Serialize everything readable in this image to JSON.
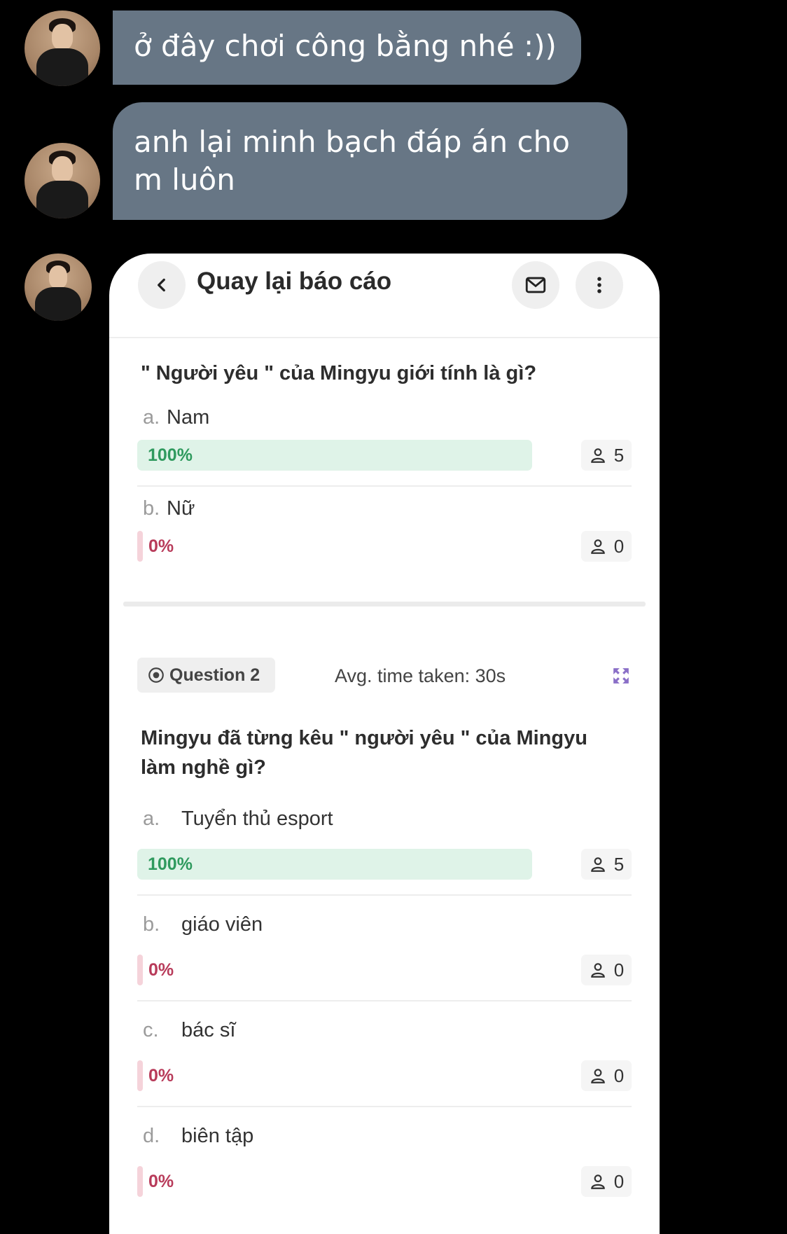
{
  "messages": [
    {
      "text": "ở đây chơi công bằng nhé :))"
    },
    {
      "text": "anh lại minh bạch đáp án cho m luôn"
    }
  ],
  "card": {
    "header_title": "Quay lại báo cáo",
    "icons": {
      "back": "chevron-left-icon",
      "mail": "mail-icon",
      "more": "more-vertical-icon"
    },
    "question1": {
      "text": "\" Người yêu \" của Mingyu giới tính là gì?",
      "options": [
        {
          "letter": "a.",
          "label": "Nam",
          "percent": "100%",
          "count": "5",
          "fill": 1.0
        },
        {
          "letter": "b.",
          "label": "Nữ",
          "percent": "0%",
          "count": "0",
          "fill": 0.0
        }
      ]
    },
    "question2": {
      "badge": "Question 2",
      "avg_time": "Avg. time taken: 30s",
      "text": "Mingyu đã từng kêu \" người yêu \" của Mingyu làm nghề gì?",
      "options": [
        {
          "letter": "a.",
          "label": "Tuyển thủ esport",
          "percent": "100%",
          "count": "5",
          "fill": 1.0
        },
        {
          "letter": "b.",
          "label": "giáo viên",
          "percent": "0%",
          "count": "0",
          "fill": 0.0
        },
        {
          "letter": "c.",
          "label": "bác sĩ",
          "percent": "0%",
          "count": "0",
          "fill": 0.0
        },
        {
          "letter": "d.",
          "label": "biên tập",
          "percent": "0%",
          "count": "0",
          "fill": 0.0
        }
      ]
    }
  },
  "colors": {
    "bubble": "#677685",
    "correct_bar": "#dff3e8",
    "correct_text": "#2f9a5e",
    "wrong_text": "#b83b5a",
    "accent_purple": "#8a6fc7"
  }
}
